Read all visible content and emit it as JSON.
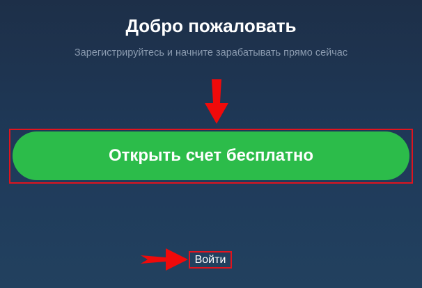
{
  "header": {
    "title": "Добро пожаловать",
    "subtitle": "Зарегистрируйтесь и начните зарабатывать прямо сейчас"
  },
  "cta": {
    "label": "Открыть счет бесплатно"
  },
  "login": {
    "label": "Войти"
  },
  "colors": {
    "background": "#1f3a5a",
    "cta_green": "#2cbc4a",
    "highlight_red": "#e0141e",
    "subtitle_gray": "#8b9bb0"
  },
  "annotations": {
    "arrow_down_icon": "arrow-down-icon",
    "arrow_right_icon": "arrow-right-icon"
  }
}
